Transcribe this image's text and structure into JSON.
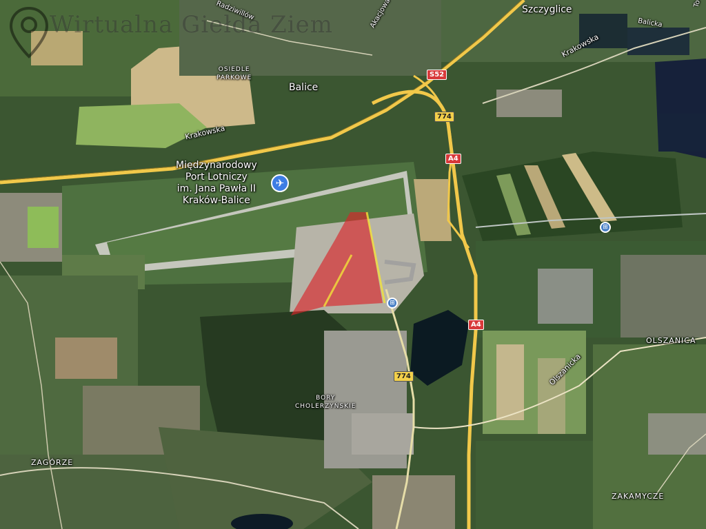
{
  "map": {
    "watermark": "Wirtualna Giełda Ziem",
    "airport": {
      "line1": "Międzynarodowy",
      "line2": "Port Lotniczy",
      "line3": "im. Jana Pawła II",
      "line4": "Kraków-Balice",
      "icon": "airplane-icon"
    },
    "places": {
      "szczyglice": "Szczyglice",
      "balice": "Balice",
      "osiedle_parkowe_1": "OSIEDLE",
      "osiedle_parkowe_2": "PARKOWE",
      "olszanica": "OLSZANICA",
      "bory_1": "BORY",
      "bory_2": "CHOLERZYŃSKIE",
      "zagorze": "ZAGÓRZE",
      "zakamycze": "ZAKAMYCZE"
    },
    "streets": {
      "krakowska_left": "Krakowska",
      "krakowska_right": "Krakowska",
      "radzikowo": "Radziwillów",
      "akacjowa": "Akacjowa",
      "balicka": "Balicka",
      "olszanicka": "Olszanicka",
      "to": "To"
    },
    "road_shields": {
      "s52": "S52",
      "r774_top": "774",
      "a4_top": "A4",
      "a4_bottom": "A4",
      "r774_bottom": "774"
    },
    "colors": {
      "parcel_red": "#d8252a",
      "parcel_yellow": "#f2e23a",
      "road_yellow": "#f1c84a",
      "shield_red": "#d8393a",
      "airport_blue": "#3d7de3",
      "rail_blue": "#4a80c6"
    }
  }
}
